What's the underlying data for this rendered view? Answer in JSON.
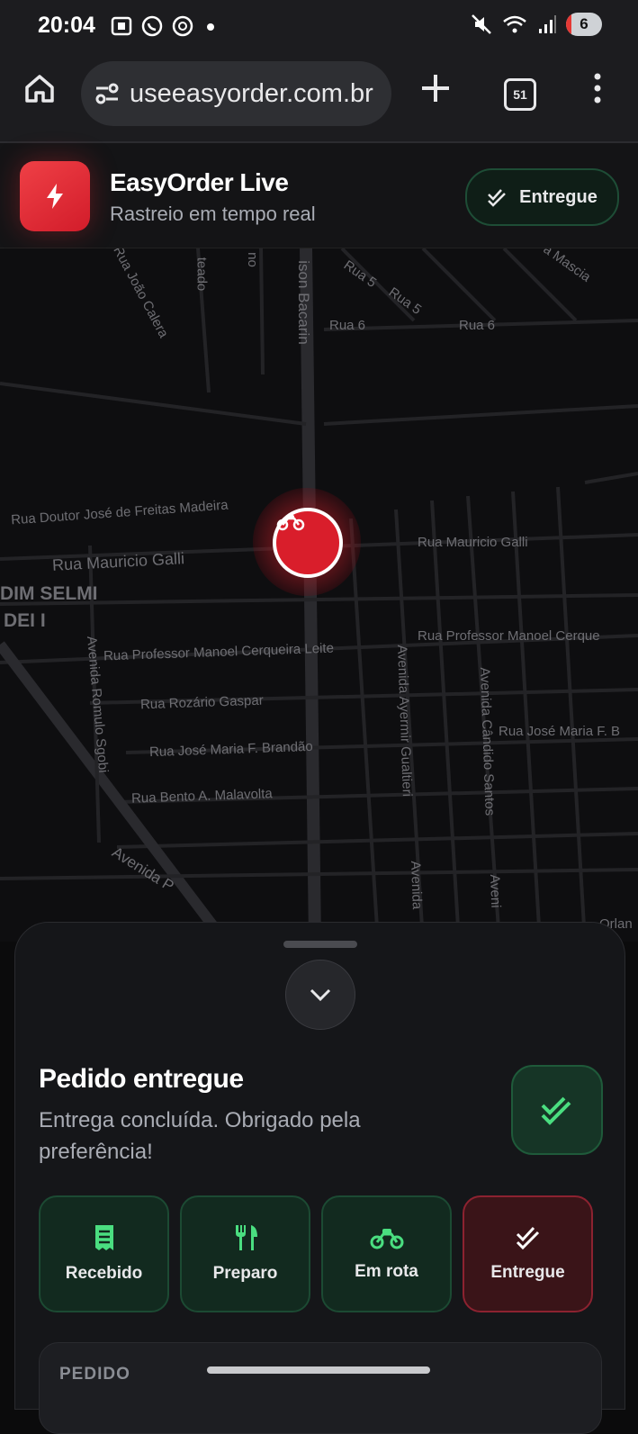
{
  "status_bar": {
    "time": "20:04",
    "battery_level": "6",
    "notification_icons": [
      "screenshot-icon",
      "whatsapp-icon",
      "chatgpt-icon",
      "dot-icon"
    ],
    "system_icons": [
      "mute-icon",
      "wifi-icon",
      "signal-icon",
      "battery-icon"
    ]
  },
  "browser": {
    "url": "useeasyorder.com.br",
    "tab_count": "51",
    "icons": [
      "home-icon",
      "site-settings-icon",
      "new-tab-icon",
      "tabs-icon",
      "menu-icon"
    ]
  },
  "app_header": {
    "title": "EasyOrder Live",
    "subtitle": "Rastreio em tempo real",
    "status_pill": "Entregue",
    "brand_color": "#e52a35"
  },
  "map": {
    "labels": [
      "Rua João Calera",
      "teado",
      "no",
      "ison Bacarin",
      "Rua 5",
      "Rua 5",
      "a Mascia",
      "Rua 6",
      "Rua 6",
      "Rua Doutor José de Freitas Madeira",
      "Rua Mauricio Galli",
      "Rua Mauricio Galli",
      "DIM SELMI",
      "DEI I",
      "Rua Professor Manoel Cerqueira Leite",
      "Rua Professor Manoel Cerque",
      "Rua Rozário Gaspar",
      "Rua José Maria F. Brandão",
      "Rua José Maria F. B",
      "Rua Bento A. Malavolta",
      "Avenida Romulo Sgobi",
      "Avenida Ayermir Gualtieri",
      "Avenida Cândido Santos",
      "Avenida P",
      "Avenida",
      "Aveni",
      "Orlan"
    ],
    "marker_icon": "motorcycle-icon"
  },
  "sheet": {
    "title": "Pedido entregue",
    "subtitle": "Entrega concluída. Obrigado pela preferência!",
    "steps": [
      {
        "label": "Recebido",
        "icon": "receipt-icon",
        "state": "done"
      },
      {
        "label": "Preparo",
        "icon": "utensils-icon",
        "state": "done"
      },
      {
        "label": "Em rota",
        "icon": "motorcycle-icon",
        "state": "done"
      },
      {
        "label": "Entregue",
        "icon": "double-check-icon",
        "state": "current"
      }
    ],
    "order_section_label": "PEDIDO",
    "colors": {
      "success": "#4ade80",
      "current": "#8c2230"
    }
  }
}
